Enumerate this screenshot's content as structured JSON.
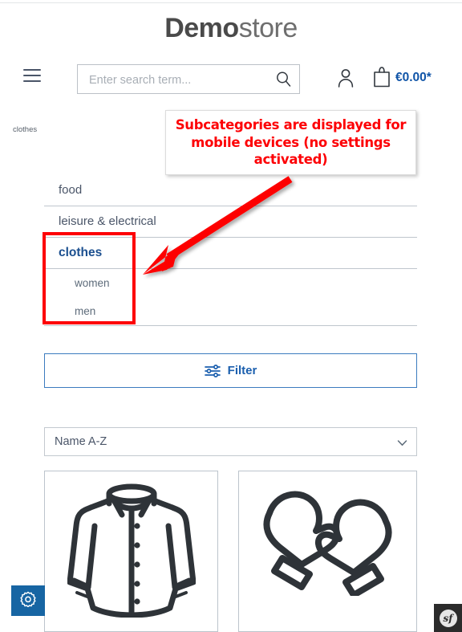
{
  "header": {
    "logo_bold": "Demo",
    "logo_light": "store",
    "menu_icon": "hamburger-menu-icon",
    "search": {
      "placeholder": "Enter search term...",
      "value": "",
      "icon": "search-icon"
    },
    "account_icon": "person-icon",
    "cart_icon": "shopping-bag-icon",
    "cart_amount": "€0.00*",
    "cart_amount_color": "#1155a8"
  },
  "breadcrumb": {
    "items": [
      "clothes"
    ]
  },
  "categories": [
    {
      "label": "food",
      "active": false,
      "children": []
    },
    {
      "label": "leisure & electrical",
      "active": false,
      "children": []
    },
    {
      "label": "clothes",
      "active": true,
      "children": [
        {
          "label": "women"
        },
        {
          "label": "men"
        }
      ]
    }
  ],
  "filter": {
    "label": "Filter",
    "icon": "sliders-filter-icon",
    "accent_color": "#1b5fae"
  },
  "sort": {
    "selected": "Name A-Z",
    "chevron_icon": "chevron-down-icon"
  },
  "products": [
    {
      "image_icon": "jacket-icon"
    },
    {
      "image_icon": "mittens-gloves-icon"
    }
  ],
  "annotation": {
    "text": "Subcategories are displayed for mobile devices (no settings activated)",
    "color": "#fd0005",
    "arrow_icon": "red-arrow-pointing-down-left",
    "highlight_icon": "red-rectangle-highlight"
  },
  "dev_toolbar": {
    "settings_icon": "gear-icon",
    "settings_bg": "#1765a3",
    "symfony_badge": "sf",
    "symfony_bg": "#2b2b2b"
  }
}
